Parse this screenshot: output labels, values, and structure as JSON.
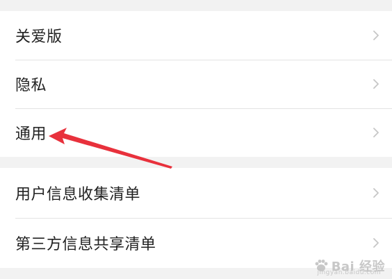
{
  "settings": {
    "group1": [
      {
        "label": "关爱版"
      },
      {
        "label": "隐私"
      },
      {
        "label": "通用"
      }
    ],
    "group2": [
      {
        "label": "用户信息收集清单"
      },
      {
        "label": "第三方信息共享清单"
      }
    ]
  },
  "icons": {
    "chevron": "chevron-right-icon",
    "annotation": "red-arrow-annotation",
    "watermark_logo": "baidu-paw-icon"
  },
  "colors": {
    "annotation_red": "#e8313c",
    "text": "#222222",
    "chevron": "#c6c6c6",
    "background": "#f2f2f2"
  },
  "watermark": {
    "text": "Bai 经验",
    "url": "jingyan.baidu.com"
  }
}
